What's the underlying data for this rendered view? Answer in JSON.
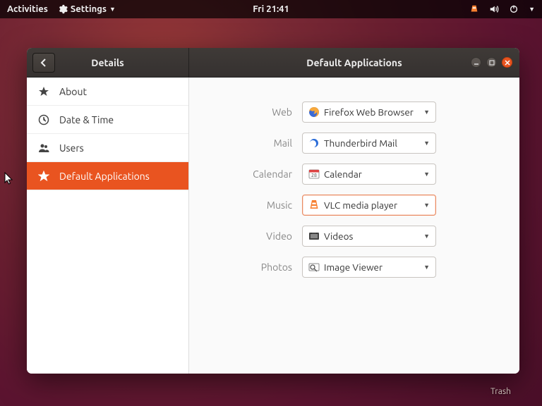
{
  "topbar": {
    "activities": "Activities",
    "settings": "Settings",
    "clock": "Fri 21:41"
  },
  "window": {
    "left_title": "Details",
    "right_title": "Default Applications"
  },
  "sidebar": {
    "items": [
      {
        "label": "About"
      },
      {
        "label": "Date & Time"
      },
      {
        "label": "Users"
      },
      {
        "label": "Default Applications"
      }
    ]
  },
  "defaults": {
    "rows": [
      {
        "label": "Web",
        "value": "Firefox Web Browser"
      },
      {
        "label": "Mail",
        "value": "Thunderbird Mail"
      },
      {
        "label": "Calendar",
        "value": "Calendar"
      },
      {
        "label": "Music",
        "value": "VLC media player"
      },
      {
        "label": "Video",
        "value": "Videos"
      },
      {
        "label": "Photos",
        "value": "Image Viewer"
      }
    ]
  },
  "desktop": {
    "trash": "Trash"
  }
}
